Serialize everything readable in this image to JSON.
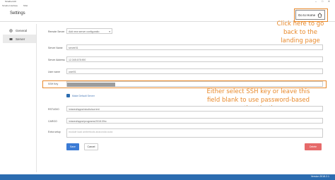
{
  "window": {
    "app_title": "Strudio-GUI",
    "controls": "–  □  ✕"
  },
  "menubar": {
    "items": [
      "Strudio Interface",
      "SSH"
    ]
  },
  "header": {
    "title": "Settings",
    "home_button_label": "Go to Home"
  },
  "sidebar": {
    "items": [
      {
        "label": "General"
      },
      {
        "label": "Server"
      }
    ]
  },
  "form": {
    "remote_server_label": "Remote Server",
    "remote_server_value": "Add new server configuratio",
    "server_name_label": "Server Name",
    "server_name_value": "server01",
    "server_address_label": "Server Address",
    "server_address_value": "12.345.678.900",
    "user_name_label": "User name",
    "user_name_value": "user01",
    "ssh_key_label": "SSH Key",
    "make_default_label": "Make Default Server",
    "rstudio_label": "RSTUDIO",
    "rstudio_value": "/shared/apps/rstudio/current",
    "cargo_label": "CARGO",
    "cargo_value": "/shared/apps/rprograms/2018.09rc",
    "extra_setup_label": "Extra setup",
    "extra_setup_placeholder": "module load ambertools anaconda cuda",
    "save_label": "Save",
    "cancel_label": "Cancel",
    "delete_label": "Delete"
  },
  "status": {
    "version": "Version 2018.2.1"
  },
  "annotations": {
    "home_note": "Click here to go back to the landing page",
    "ssh_note": "Either select SSH key or leave this field blank to use password-based authentication"
  },
  "colors": {
    "accent": "#2b6cb0",
    "annotation": "#e8892b",
    "delete": "#e66a6a"
  }
}
